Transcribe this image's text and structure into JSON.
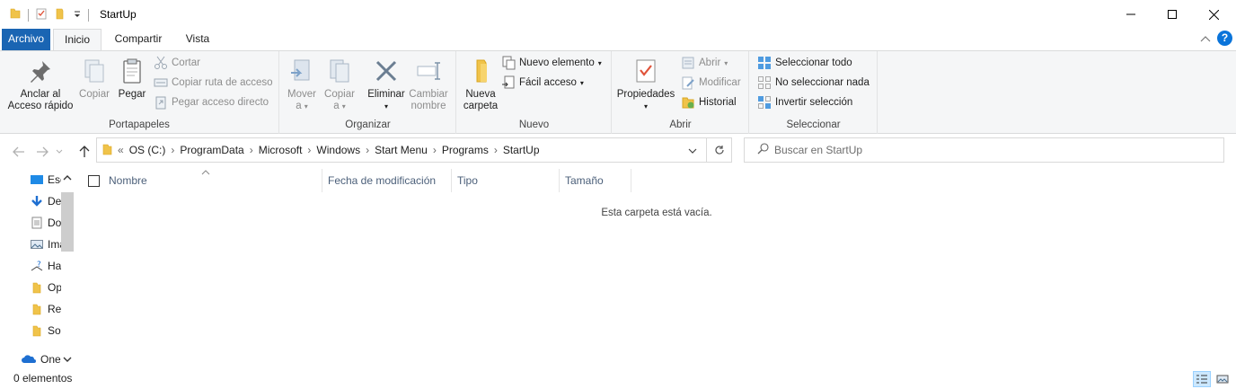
{
  "window": {
    "title": "StartUp"
  },
  "tabs": [
    {
      "label": "Archivo"
    },
    {
      "label": "Inicio"
    },
    {
      "label": "Compartir"
    },
    {
      "label": "Vista"
    }
  ],
  "ribbon": {
    "portapapeles": {
      "label": "Portapapeles",
      "pin": "Anclar al Acceso rápido",
      "copy": "Copiar",
      "paste": "Pegar",
      "cut": "Cortar",
      "copy_path": "Copiar ruta de acceso",
      "paste_shortcut": "Pegar acceso directo"
    },
    "organizar": {
      "label": "Organizar",
      "move_line1": "Mover",
      "move_line2": "a",
      "copy_line1": "Copiar",
      "copy_line2": "a",
      "delete": "Eliminar",
      "rename_line1": "Cambiar",
      "rename_line2": "nombre"
    },
    "nuevo": {
      "label": "Nuevo",
      "new_folder_line1": "Nueva",
      "new_folder_line2": "carpeta",
      "new_item": "Nuevo elemento",
      "easy_access": "Fácil acceso"
    },
    "abrir": {
      "label": "Abrir",
      "properties": "Propiedades",
      "open": "Abrir",
      "edit": "Modificar",
      "history": "Historial"
    },
    "seleccionar": {
      "label": "Seleccionar",
      "select_all": "Seleccionar todo",
      "select_none": "No seleccionar nada",
      "invert": "Invertir selección"
    }
  },
  "address": {
    "overflow": "«",
    "breadcrumbs": [
      "OS (C:)",
      "ProgramData",
      "Microsoft",
      "Windows",
      "Start Menu",
      "Programs",
      "StartUp"
    ]
  },
  "search": {
    "placeholder": "Buscar en StartUp"
  },
  "nav_pane": {
    "items": [
      {
        "label": "Escritorio",
        "icon": "desktop-icon"
      },
      {
        "label": "Descargas",
        "icon": "download-icon"
      },
      {
        "label": "Documentos",
        "icon": "document-icon"
      },
      {
        "label": "Imágenes",
        "icon": "pictures-icon"
      },
      {
        "label": "Hash",
        "icon": "network-icon"
      },
      {
        "label": "Op",
        "icon": "folder-icon"
      },
      {
        "label": "Re",
        "icon": "folder-icon"
      },
      {
        "label": "So",
        "icon": "folder-icon"
      },
      {
        "label": "OneDrive",
        "icon": "onedrive-icon"
      }
    ]
  },
  "columns": [
    {
      "label": "Nombre"
    },
    {
      "label": "Fecha de modificación"
    },
    {
      "label": "Tipo"
    },
    {
      "label": "Tamaño"
    }
  ],
  "content": {
    "empty_message": "Esta carpeta está vacía."
  },
  "status": {
    "item_count": "0 elementos"
  },
  "colors": {
    "file_tab": "#1a65b3",
    "folder": "#f0c34a",
    "accent": "#0a74da"
  }
}
